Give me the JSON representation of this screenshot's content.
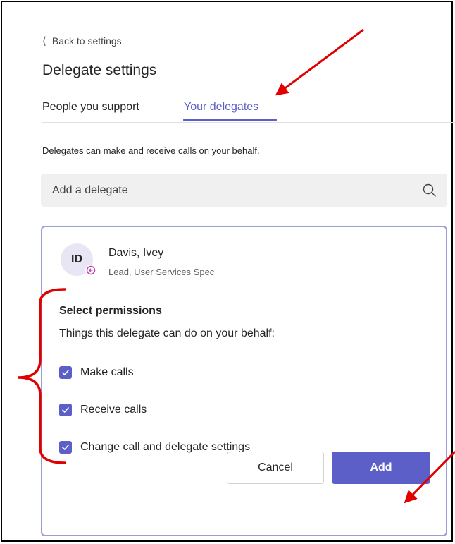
{
  "header": {
    "back_label": "Back to settings",
    "title": "Delegate settings"
  },
  "tabs": [
    {
      "label": "People you support",
      "selected": false
    },
    {
      "label": "Your delegates",
      "selected": true
    }
  ],
  "description": "Delegates can make and receive calls on your behalf.",
  "search": {
    "placeholder": "Add a delegate",
    "icon": "search-icon"
  },
  "delegate_card": {
    "person": {
      "initials": "ID",
      "name": "Davis, Ivey",
      "title": "Lead, User Services Spec",
      "presence_icon": "presence-out-of-office-icon"
    },
    "permissions_title": "Select permissions",
    "permissions_description": "Things this delegate can do on your behalf:",
    "permissions": [
      {
        "label": "Make calls",
        "checked": true
      },
      {
        "label": "Receive calls",
        "checked": true
      },
      {
        "label": "Change call and delegate settings",
        "checked": true
      }
    ],
    "cancel_label": "Cancel",
    "add_label": "Add"
  },
  "colors": {
    "accent": "#5b5fc7",
    "card_border": "#9a9ed6",
    "annotation": "#e00000",
    "presence": "#c239b3"
  }
}
